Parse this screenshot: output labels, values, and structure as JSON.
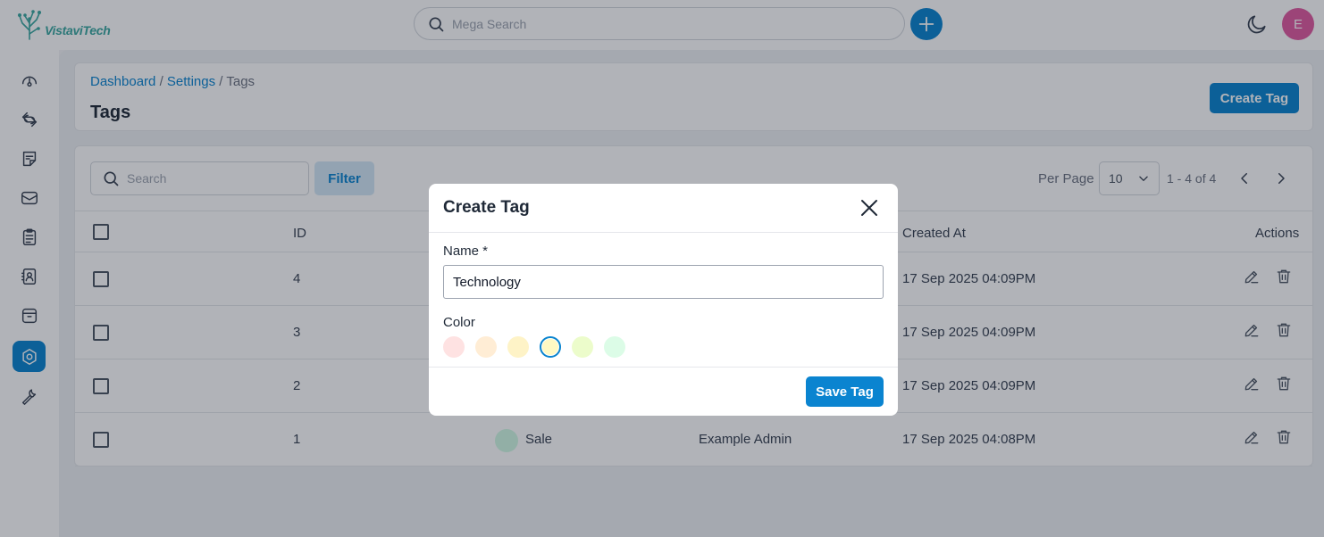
{
  "app": {
    "logo_text": "VistaviTech",
    "avatar_initial": "E"
  },
  "topbar": {
    "search_placeholder": "Mega Search"
  },
  "sidebar": {
    "items": [
      {
        "icon": "dashboard-gauge-icon",
        "active": false
      },
      {
        "icon": "integrations-icon",
        "active": false
      },
      {
        "icon": "notes-icon",
        "active": false
      },
      {
        "icon": "inbox-icon",
        "active": false
      },
      {
        "icon": "clipboard-icon",
        "active": false
      },
      {
        "icon": "contacts-icon",
        "active": false
      },
      {
        "icon": "archive-icon",
        "active": false
      },
      {
        "icon": "settings-icon",
        "active": true
      },
      {
        "icon": "wrench-icon",
        "active": false
      }
    ]
  },
  "header": {
    "breadcrumb": [
      "Dashboard",
      "Settings",
      "Tags"
    ],
    "separator": "/",
    "title": "Tags",
    "create_button": "Create Tag"
  },
  "toolbar": {
    "search_placeholder": "Search",
    "filter_label": "Filter",
    "per_page_label": "Per Page",
    "per_page_value": "10",
    "page_range": "1 - 4 of 4"
  },
  "table": {
    "columns": [
      "ID",
      "Created At",
      "Actions"
    ],
    "rows": [
      {
        "id": "4",
        "name": "",
        "created_by": "",
        "created_at": "17 Sep 2025 04:09PM",
        "tag_color": ""
      },
      {
        "id": "3",
        "name": "",
        "created_by": "",
        "created_at": "17 Sep 2025 04:09PM",
        "tag_color": ""
      },
      {
        "id": "2",
        "name": "",
        "created_by": "",
        "created_at": "17 Sep 2025 04:09PM",
        "tag_color": ""
      },
      {
        "id": "1",
        "name": "Sale",
        "created_by": "Example Admin",
        "created_at": "17 Sep 2025 04:08PM",
        "tag_color": "#d1fae5"
      }
    ]
  },
  "modal": {
    "title": "Create Tag",
    "name_label": "Name *",
    "name_value": "Technology",
    "color_label": "Color",
    "colors": [
      "#fee2e2",
      "#ffedd5",
      "#fef3c7",
      "#fef9c3",
      "#ecfccb",
      "#dcfce7"
    ],
    "selected_color_index": 3,
    "save_label": "Save Tag"
  },
  "colors": {
    "accent": "#0a84d0",
    "avatar": "#e05aa0",
    "logo": "#3aa7a0"
  }
}
